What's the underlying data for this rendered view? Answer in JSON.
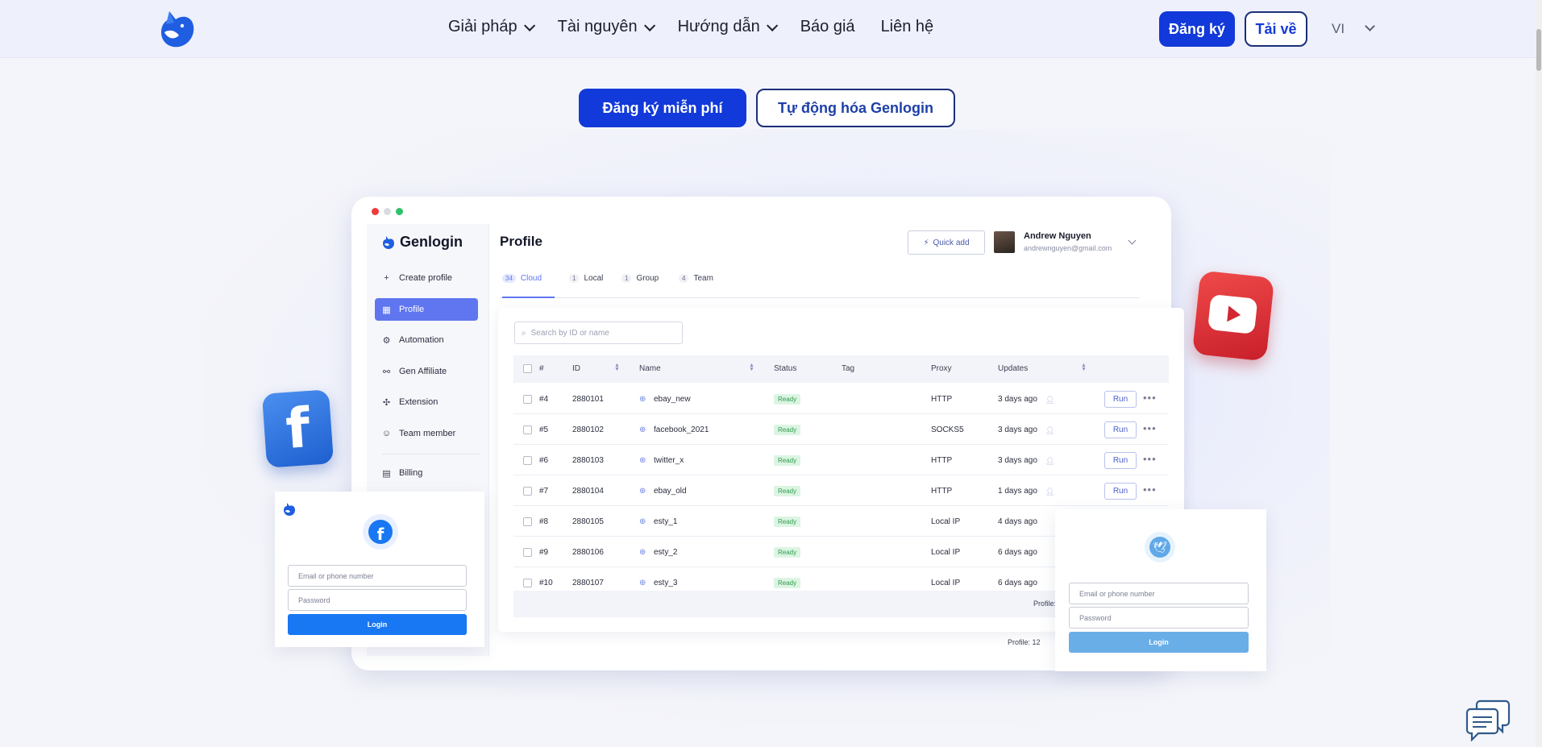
{
  "nav": {
    "items": [
      {
        "label": "Giải pháp",
        "has_dropdown": true
      },
      {
        "label": "Tài nguyên",
        "has_dropdown": true
      },
      {
        "label": "Hướng dẫn",
        "has_dropdown": true
      },
      {
        "label": "Báo giá",
        "has_dropdown": false
      },
      {
        "label": "Liên hệ",
        "has_dropdown": false
      }
    ],
    "signup_label": "Đăng ký",
    "download_label": "Tải về",
    "language": "VI"
  },
  "hero": {
    "primary_cta": "Đăng ký miễn phí",
    "secondary_cta": "Tự động hóa Genlogin"
  },
  "app": {
    "brand": "Genlogin",
    "sidebar": [
      {
        "label": "Create profile",
        "icon": "plus-icon",
        "active": false
      },
      {
        "label": "Profile",
        "icon": "grid-icon",
        "active": true
      },
      {
        "label": "Automation",
        "icon": "automation-icon",
        "active": false
      },
      {
        "label": "Gen Affiliate",
        "icon": "affiliate-icon",
        "active": false
      },
      {
        "label": "Extension",
        "icon": "puzzle-icon",
        "active": false
      },
      {
        "label": "Team member",
        "icon": "team-icon",
        "active": false
      },
      {
        "label": "Billing",
        "icon": "billing-icon",
        "active": false
      }
    ],
    "page_title": "Profile",
    "quick_add": "Quick add",
    "user": {
      "name": "Andrew Nguyen",
      "email": "andrewnguyen@gmail.com"
    },
    "tabs": [
      {
        "count": "34",
        "label": "Cloud",
        "active": true
      },
      {
        "count": "1",
        "label": "Local",
        "active": false
      },
      {
        "count": "1",
        "label": "Group",
        "active": false
      },
      {
        "count": "4",
        "label": "Team",
        "active": false
      }
    ],
    "search_placeholder": "Search by ID or name",
    "columns": [
      "#",
      "ID",
      "Name",
      "Status",
      "Tag",
      "Proxy",
      "Updates"
    ],
    "rows": [
      {
        "num": "#4",
        "id": "2880101",
        "name": "ebay_new",
        "status": "Ready",
        "proxy": "HTTP",
        "updated": "3 days ago",
        "run": true
      },
      {
        "num": "#5",
        "id": "2880102",
        "name": "facebook_2021",
        "status": "Ready",
        "proxy": "SOCKS5",
        "updated": "3 days ago",
        "run": true
      },
      {
        "num": "#6",
        "id": "2880103",
        "name": "twitter_x",
        "status": "Ready",
        "proxy": "HTTP",
        "updated": "3 days ago",
        "run": true
      },
      {
        "num": "#7",
        "id": "2880104",
        "name": "ebay_old",
        "status": "Ready",
        "proxy": "HTTP",
        "updated": "1 days ago",
        "run": true
      },
      {
        "num": "#8",
        "id": "2880105",
        "name": "esty_1",
        "status": "Ready",
        "proxy": "Local IP",
        "updated": "4 days ago",
        "run": false
      },
      {
        "num": "#9",
        "id": "2880106",
        "name": "esty_2",
        "status": "Ready",
        "proxy": "Local IP",
        "updated": "6 days ago",
        "run": false
      },
      {
        "num": "#10",
        "id": "2880107",
        "name": "esty_3",
        "status": "Ready",
        "proxy": "Local IP",
        "updated": "6 days ago",
        "run": false
      }
    ],
    "run_label": "Run",
    "footer_count_a": "Profile:",
    "footer_count_b": "Profile: 12"
  },
  "login_left": {
    "email_placeholder": "Email or phone number",
    "password_placeholder": "Password",
    "button": "Login"
  },
  "login_right": {
    "email_placeholder": "Email or phone number",
    "password_placeholder": "Password",
    "button": "Login"
  },
  "colors": {
    "primary": "#1239d9",
    "accent": "#5f76f0",
    "ready": "#2f9b4f",
    "facebook": "#1877f2",
    "twitter": "#60a8e8"
  }
}
